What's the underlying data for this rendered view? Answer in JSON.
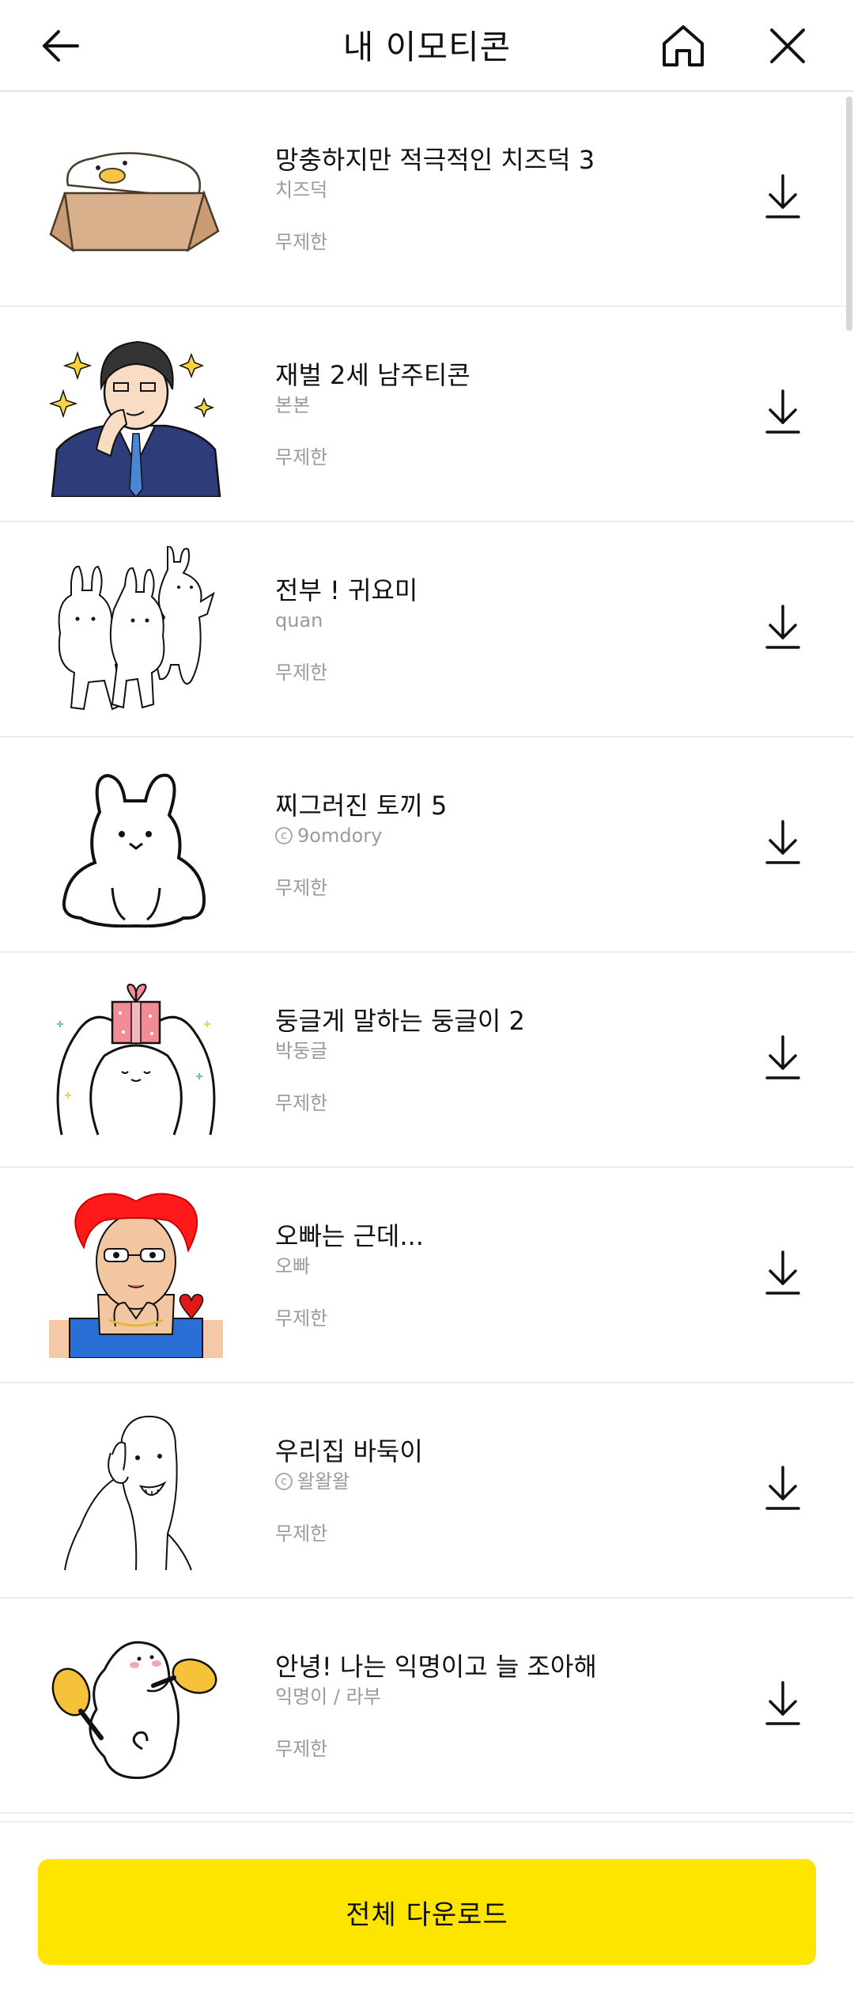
{
  "header": {
    "title": "내 이모티콘",
    "back_icon": "arrow-left-icon",
    "home_icon": "home-icon",
    "close_icon": "close-icon"
  },
  "emoticons": [
    {
      "title": "망충하지만 적극적인 치즈덕 3",
      "author": "치즈덕",
      "copyright": false,
      "validity": "무제한",
      "thumb_icon": "duck-in-box-sticker"
    },
    {
      "title": "재벌 2세 남주티콘",
      "author": "본본",
      "copyright": false,
      "validity": "무제한",
      "thumb_icon": "suit-man-sticker"
    },
    {
      "title": "전부 ! 귀요미",
      "author": "quan",
      "copyright": false,
      "validity": "무제한",
      "thumb_icon": "bunnies-sticker"
    },
    {
      "title": "찌그러진 토끼 5",
      "author": "9omdory",
      "copyright": true,
      "validity": "무제한",
      "thumb_icon": "white-rabbit-sticker"
    },
    {
      "title": "둥글게 말하는 둥글이 2",
      "author": "박둥글",
      "copyright": false,
      "validity": "무제한",
      "thumb_icon": "gift-blob-sticker"
    },
    {
      "title": "오빠는 근데...",
      "author": "오빠",
      "copyright": false,
      "validity": "무제한",
      "thumb_icon": "red-hair-man-sticker"
    },
    {
      "title": "우리집 바둑이",
      "author": "왈왈왈",
      "copyright": true,
      "validity": "무제한",
      "thumb_icon": "thumbs-up-dog-sticker"
    },
    {
      "title": "안녕! 나는 익명이고 늘 조아해",
      "author": "익명이 / 라부",
      "copyright": false,
      "validity": "무제한",
      "thumb_icon": "maracas-blob-sticker"
    }
  ],
  "row_download_icon": "download-icon",
  "footer": {
    "download_all_label": "전체 다운로드"
  },
  "colors": {
    "accent": "#fee500",
    "muted_text": "#9a9a9a",
    "divider": "#ececec"
  }
}
